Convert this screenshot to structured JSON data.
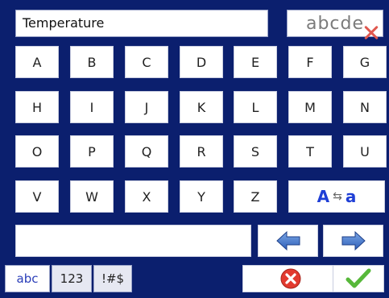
{
  "input": {
    "value": "Temperature"
  },
  "clear_button": {
    "label": "abcde"
  },
  "keys": {
    "row1": [
      "A",
      "B",
      "C",
      "D",
      "E",
      "F",
      "G"
    ],
    "row2": [
      "H",
      "I",
      "J",
      "K",
      "L",
      "M",
      "N"
    ],
    "row3": [
      "O",
      "P",
      "Q",
      "R",
      "S",
      "T",
      "U"
    ],
    "row4": [
      "V",
      "W",
      "X",
      "Y",
      "Z"
    ]
  },
  "case_toggle": {
    "upper": "A",
    "lower": "a"
  },
  "tabs": [
    {
      "label": "abc"
    },
    {
      "label": "123"
    },
    {
      "label": "!#$"
    }
  ],
  "icons": {
    "clear": "backspace-x-icon",
    "left": "arrow-left-icon",
    "right": "arrow-right-icon",
    "cancel": "cancel-icon",
    "ok": "checkmark-icon"
  },
  "colors": {
    "background": "#0b1f6e",
    "accent_blue": "#1f3fd6",
    "cancel_red": "#e23a2f",
    "ok_green": "#57b83a"
  }
}
